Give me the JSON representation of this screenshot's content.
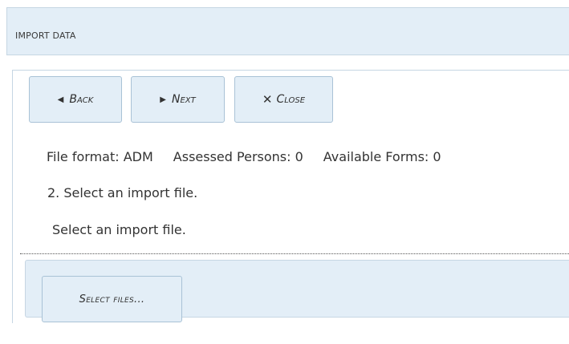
{
  "header": {
    "title": "IMPORT DATA"
  },
  "toolbar": {
    "back_label": "Back",
    "back_icon": "triangle-left-icon",
    "next_label": "Next",
    "next_icon": "triangle-right-icon",
    "close_label": "Close",
    "close_icon": "close-icon"
  },
  "info": {
    "file_format": "File format: ADM",
    "assessed_persons": "Assessed Persons: 0",
    "available_forms": "Available Forms: 0"
  },
  "step": {
    "instruction": "2. Select an import file.",
    "prompt": "Select an import file."
  },
  "upload": {
    "select_files_label": "Select files..."
  },
  "colors": {
    "header_bg": "#e3eef7",
    "button_bg": "#e3eef7",
    "button_border": "#a9c2d6",
    "text": "#333333"
  }
}
